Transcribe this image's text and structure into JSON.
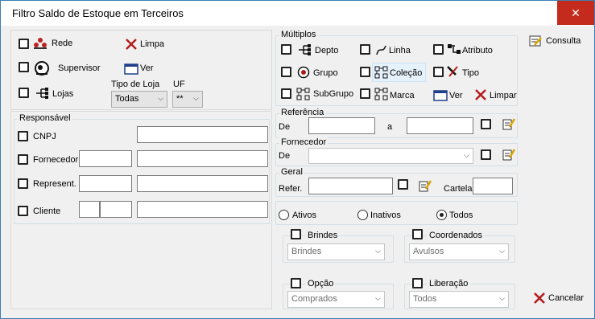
{
  "window": {
    "title": "Filtro Saldo de Estoque em Terceiros",
    "close_glyph": "✕"
  },
  "left": {
    "rede": "Rede",
    "limpa": "Limpa",
    "supervisor": "Supervisor",
    "ver": "Ver",
    "lojas": "Lojas",
    "tipo_loja_label": "Tipo de Loja",
    "tipo_loja_value": "Todas",
    "uf_label": "UF",
    "uf_value": "**"
  },
  "responsavel": {
    "title": "Responsável",
    "cnpj": "CNPJ",
    "fornecedor": "Fornecedor",
    "represent": "Represent.",
    "cliente": "Cliente"
  },
  "multiplos": {
    "title": "Múltiplos",
    "depto": "Depto",
    "linha": "Linha",
    "atributo": "Atributo",
    "grupo": "Grupo",
    "colecao": "Coleção",
    "tipo": "Tipo",
    "subgrupo": "SubGrupo",
    "marca": "Marca",
    "ver": "Ver",
    "limpar": "Limpar"
  },
  "referencia": {
    "title": "Referência",
    "de": "De",
    "a": "a"
  },
  "fornecedor": {
    "title": "Fornecedor",
    "de": "De"
  },
  "geral": {
    "title": "Geral",
    "refer": "Refer.",
    "cartela": "Cartela"
  },
  "status": {
    "ativos": "Ativos",
    "inativos": "Inativos",
    "todos": "Todos",
    "selected": "todos"
  },
  "filters": {
    "brindes": {
      "label": "Brindes",
      "value": "Brindes"
    },
    "coordenados": {
      "label": "Coordenados",
      "value": "Avulsos"
    },
    "opcao": {
      "label": "Opção",
      "value": "Comprados"
    },
    "liberacao": {
      "label": "Liberação",
      "value": "Todos"
    }
  },
  "buttons": {
    "consulta": "Consulta",
    "cancelar": "Cancelar"
  },
  "colors": {
    "close": "#c42b1c",
    "accent_blue": "#1e6fb8",
    "red_x": "#b31b1b"
  }
}
